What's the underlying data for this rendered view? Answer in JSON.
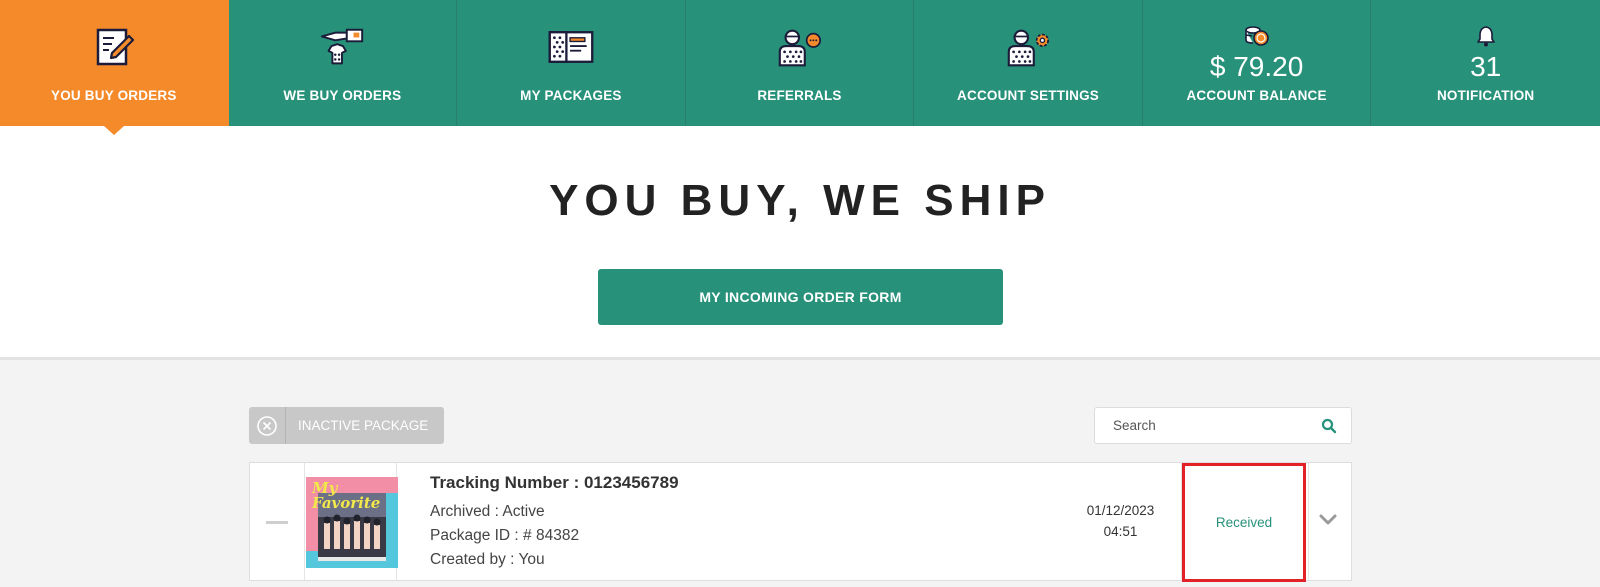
{
  "nav": {
    "items": [
      {
        "label": "YOU BUY ORDERS",
        "icon": "document-pen-icon",
        "active": true
      },
      {
        "label": "WE BUY ORDERS",
        "icon": "hand-shirt-icon",
        "active": false
      },
      {
        "label": "MY PACKAGES",
        "icon": "packages-icon",
        "active": false
      },
      {
        "label": "REFERRALS",
        "icon": "user-chat-icon",
        "active": false
      },
      {
        "label": "ACCOUNT SETTINGS",
        "icon": "user-gear-icon",
        "active": false
      },
      {
        "label": "ACCOUNT BALANCE",
        "value": "$ 79.20",
        "icon": "coins-icon",
        "active": false
      },
      {
        "label": "NOTIFICATION",
        "value": "31",
        "icon": "bell-icon",
        "active": false
      }
    ]
  },
  "hero": {
    "title": "YOU BUY, WE SHIP",
    "button_label": "MY INCOMING ORDER FORM"
  },
  "toolbar": {
    "inactive_label": "INACTIVE PACKAGE",
    "search_placeholder": "Search"
  },
  "package": {
    "tracking": "Tracking Number : 0123456789",
    "archived": "Archived : Active",
    "package_id": "Package ID : # 84382",
    "created_by": "Created by : You",
    "date": "01/12/2023",
    "time": "04:51",
    "status": "Received",
    "thumbnail_title": "My Favorite"
  },
  "colors": {
    "nav_green": "#27917a",
    "active_orange": "#f58a2b",
    "status_green": "#27917a",
    "highlight_red": "#e32228"
  }
}
